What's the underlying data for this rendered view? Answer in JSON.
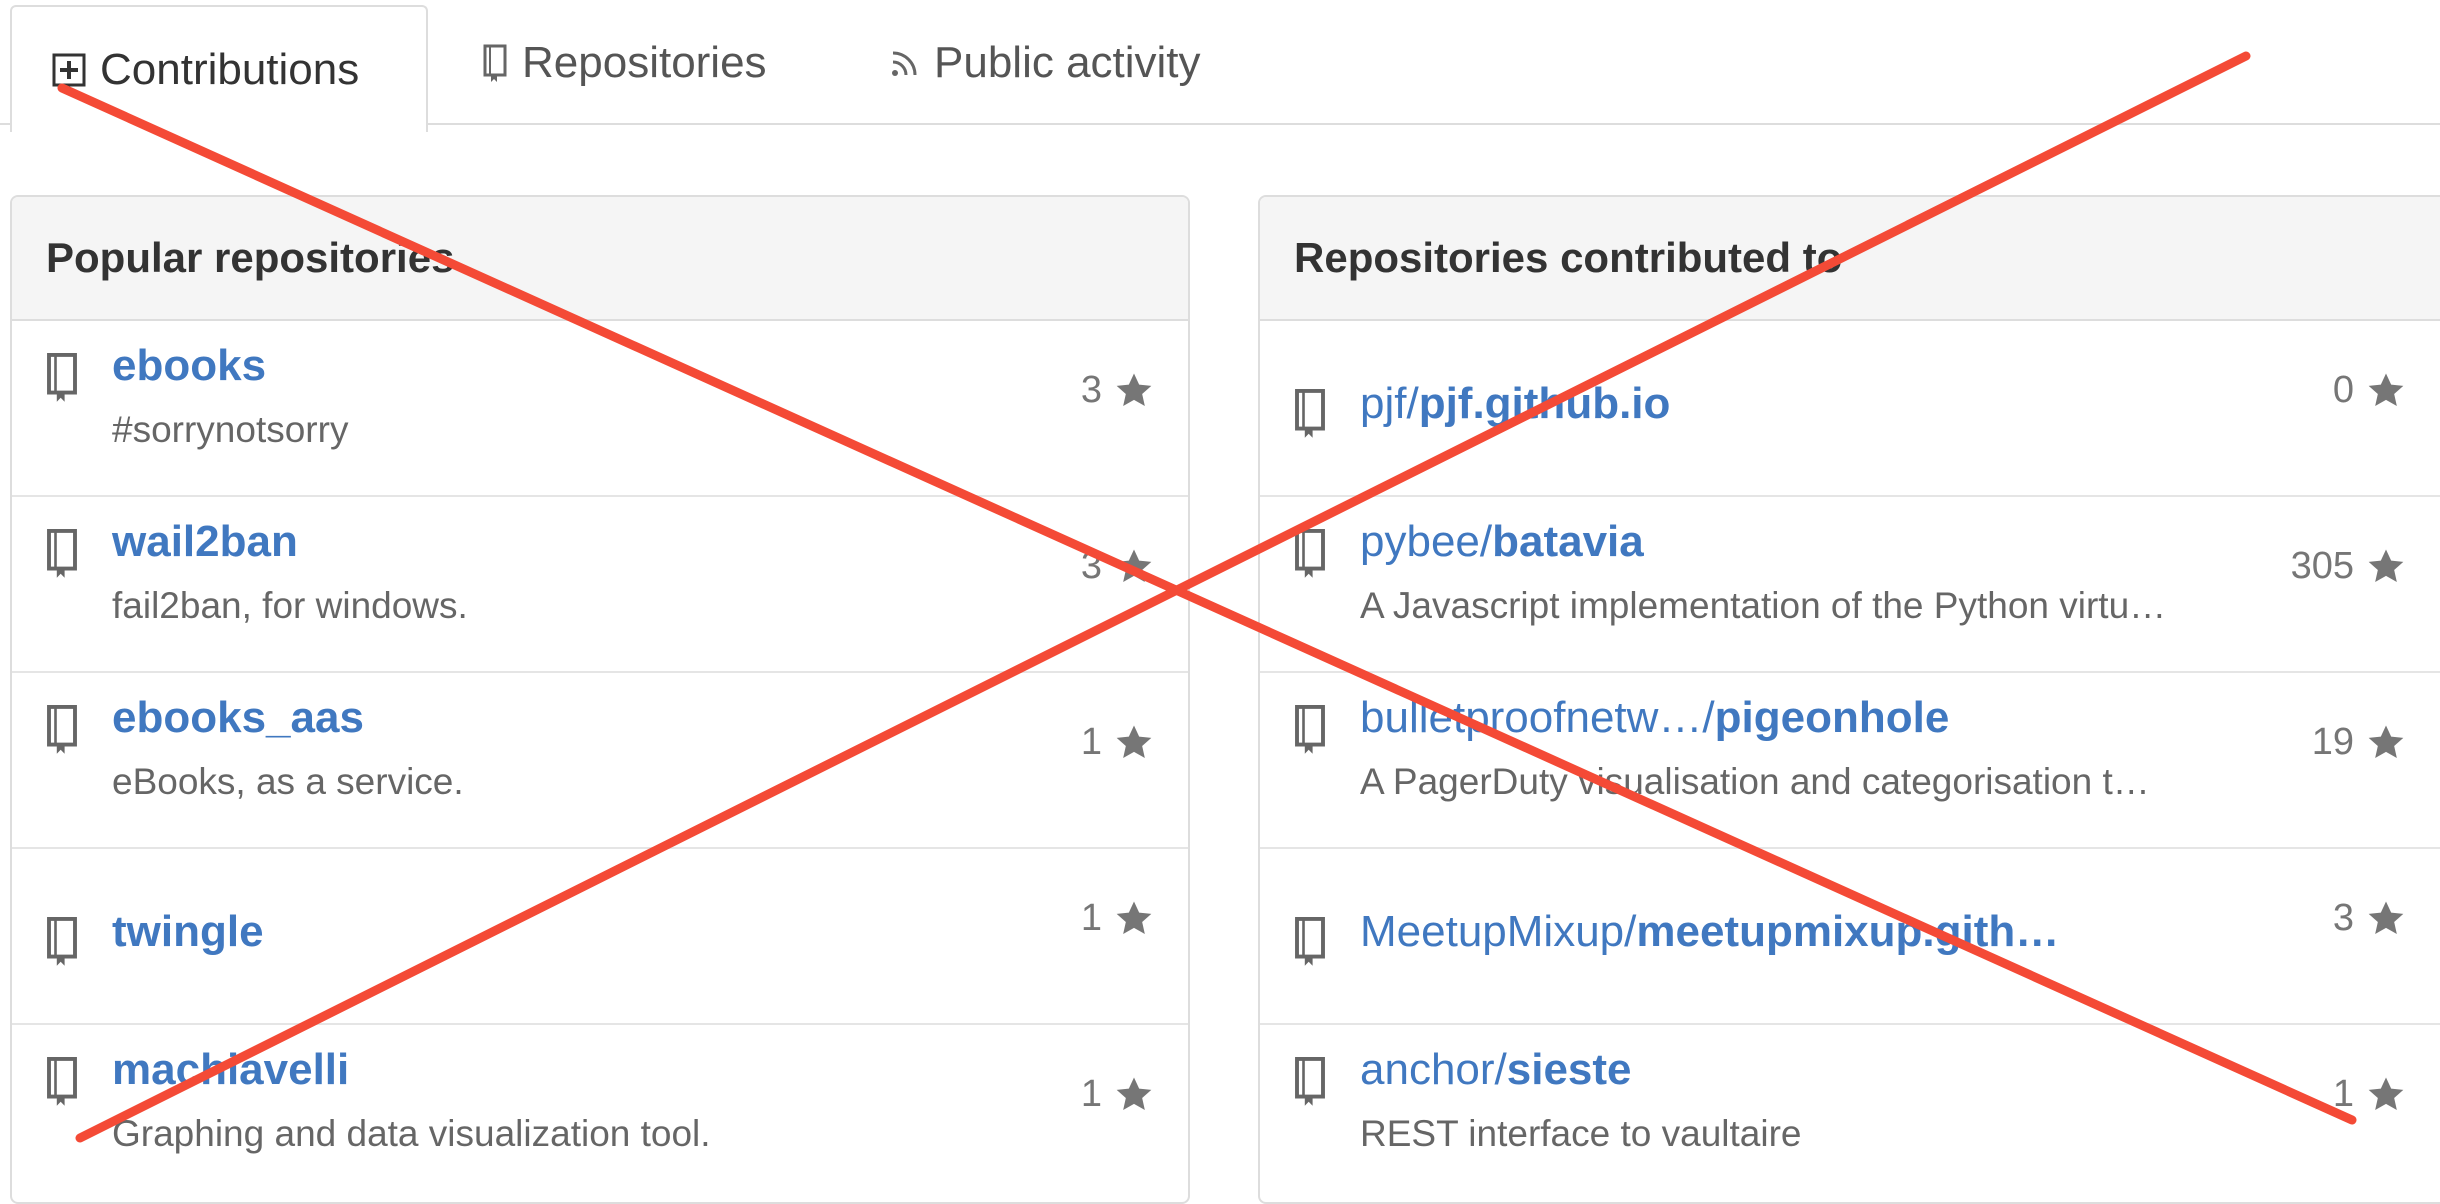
{
  "tabs": [
    {
      "label": "Contributions",
      "icon": "plus-square-icon",
      "active": true
    },
    {
      "label": "Repositories",
      "icon": "repo-book-icon",
      "active": false
    },
    {
      "label": "Public activity",
      "icon": "rss-feed-icon",
      "active": false
    }
  ],
  "popular": {
    "title": "Popular repositories",
    "items": [
      {
        "owner": "",
        "name": "ebooks",
        "description": "#sorrynotsorry",
        "stars": "3"
      },
      {
        "owner": "",
        "name": "wail2ban",
        "description": "fail2ban, for windows.",
        "stars": "3"
      },
      {
        "owner": "",
        "name": "ebooks_aas",
        "description": "eBooks, as a service.",
        "stars": "1"
      },
      {
        "owner": "",
        "name": "twingle",
        "description": "",
        "stars": "1"
      },
      {
        "owner": "",
        "name": "machiavelli",
        "description": "Graphing and data visualization tool.",
        "stars": "1"
      }
    ]
  },
  "contributed": {
    "title": "Repositories contributed to",
    "items": [
      {
        "owner": "pjf/",
        "name": "pjf.github.io",
        "description": "",
        "stars": "0"
      },
      {
        "owner": "pybee/",
        "name": "batavia",
        "description": "A Javascript implementation of the Python virtu…",
        "stars": "305"
      },
      {
        "owner": "bulletproofnetw…/",
        "name": "pigeonhole",
        "description": "A PagerDuty visualisation and categorisation t…",
        "stars": "19"
      },
      {
        "owner": "MeetupMixup/",
        "name": "meetupmixup.gith…",
        "description": "",
        "stars": "3"
      },
      {
        "owner": "anchor/",
        "name": "sieste",
        "description": "REST interface to vaultaire",
        "stars": "1"
      }
    ]
  },
  "overlay": {
    "color": "#f44a36",
    "description": "red-cross-strike-through"
  }
}
